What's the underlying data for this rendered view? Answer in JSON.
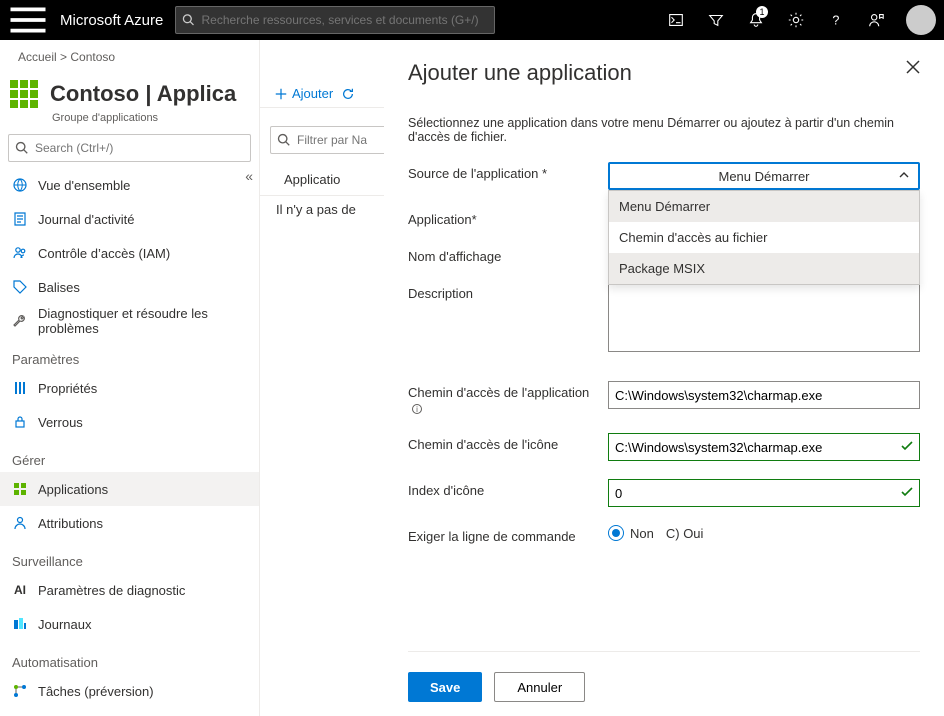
{
  "topbar": {
    "brand": "Microsoft Azure",
    "search_placeholder": "Recherche ressources, services et documents (G+/)",
    "notification_count": "1"
  },
  "breadcrumb": "Accueil >  Contoso",
  "page": {
    "title": "Contoso | Applica",
    "subtitle": "Groupe d'applications"
  },
  "side_search_placeholder": "Search (Ctrl+/)",
  "collapse_glyph": "«",
  "nav": {
    "overview": "Vue d'ensemble",
    "activity": "Journal d'activité",
    "iam": "Contrôle d’accès (IAM)",
    "tags": "Balises",
    "diagnose": "Diagnostiquer et résoudre les problèmes"
  },
  "nav_sections": {
    "params": "Paramètres",
    "manage": "Gérer",
    "surv": "Surveillance",
    "auto": "Automatisation"
  },
  "nav_params": {
    "props": "Propriétés",
    "locks": "Verrous"
  },
  "nav_manage": {
    "apps": "Applications",
    "assign": "Attributions"
  },
  "nav_surv": {
    "diag": "Paramètres de diagnostic",
    "diag_prefix": "AI",
    "logs": "Journaux"
  },
  "nav_auto": {
    "tasks": "Tâches (préversion)"
  },
  "toolbar": {
    "add": "Ajouter",
    "refresh": ""
  },
  "mid": {
    "filter_placeholder": "Filtrer par Na",
    "header_col1": "Applicatio",
    "empty": "Il n'y a pas de"
  },
  "panel": {
    "title": "Ajouter une application",
    "desc": "Sélectionnez une application dans votre menu Démarrer ou ajoutez à partir d'un chemin d'accès de fichier.",
    "label_source": "Source de l'application *",
    "label_app": "Application*",
    "label_display": "Nom d'affichage",
    "label_desc": "Description",
    "label_apppath": "Chemin d'accès de l'application",
    "label_iconpath": "Chemin d'accès de l'icône",
    "label_iconindex": "Index d'icône",
    "label_requirecmd": "Exiger la ligne de commande",
    "source_selected": "Menu Démarrer",
    "source_options": {
      "start": "Menu Démarrer",
      "filepath": "Chemin d'accès au fichier",
      "msix": "Package MSIX"
    },
    "apppath_value": "C:\\Windows\\system32\\charmap.exe",
    "iconpath_value": "C:\\Windows\\system32\\charmap.exe",
    "iconindex_value": "0",
    "radio_no": "Non",
    "radio_yes": "C) Oui",
    "btn_save": "Save",
    "btn_cancel": "Annuler"
  }
}
